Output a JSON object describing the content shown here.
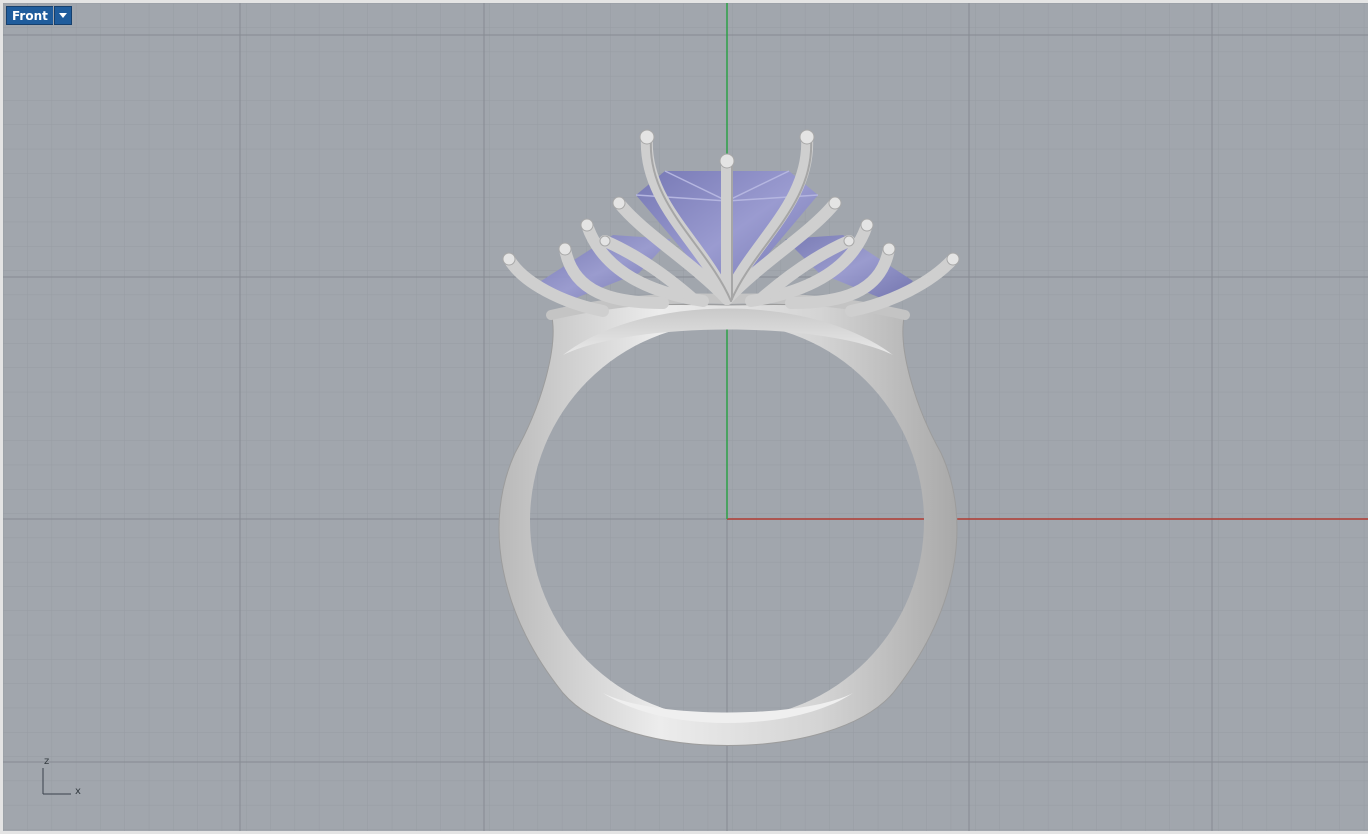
{
  "viewport": {
    "name": "Front",
    "menu_icon": "chevron-down-icon",
    "background_color": "#a1a6ad",
    "grid_minor_color": "#979ca3",
    "grid_major_color": "#868b92",
    "x_axis_color": "#b03a32",
    "z_axis_color": "#2ea048"
  },
  "axis_widget": {
    "vertical_label": "z",
    "horizontal_label": "x"
  },
  "model": {
    "metal_color": "#d8d8d8",
    "gem_color": "#8e8fc4"
  }
}
